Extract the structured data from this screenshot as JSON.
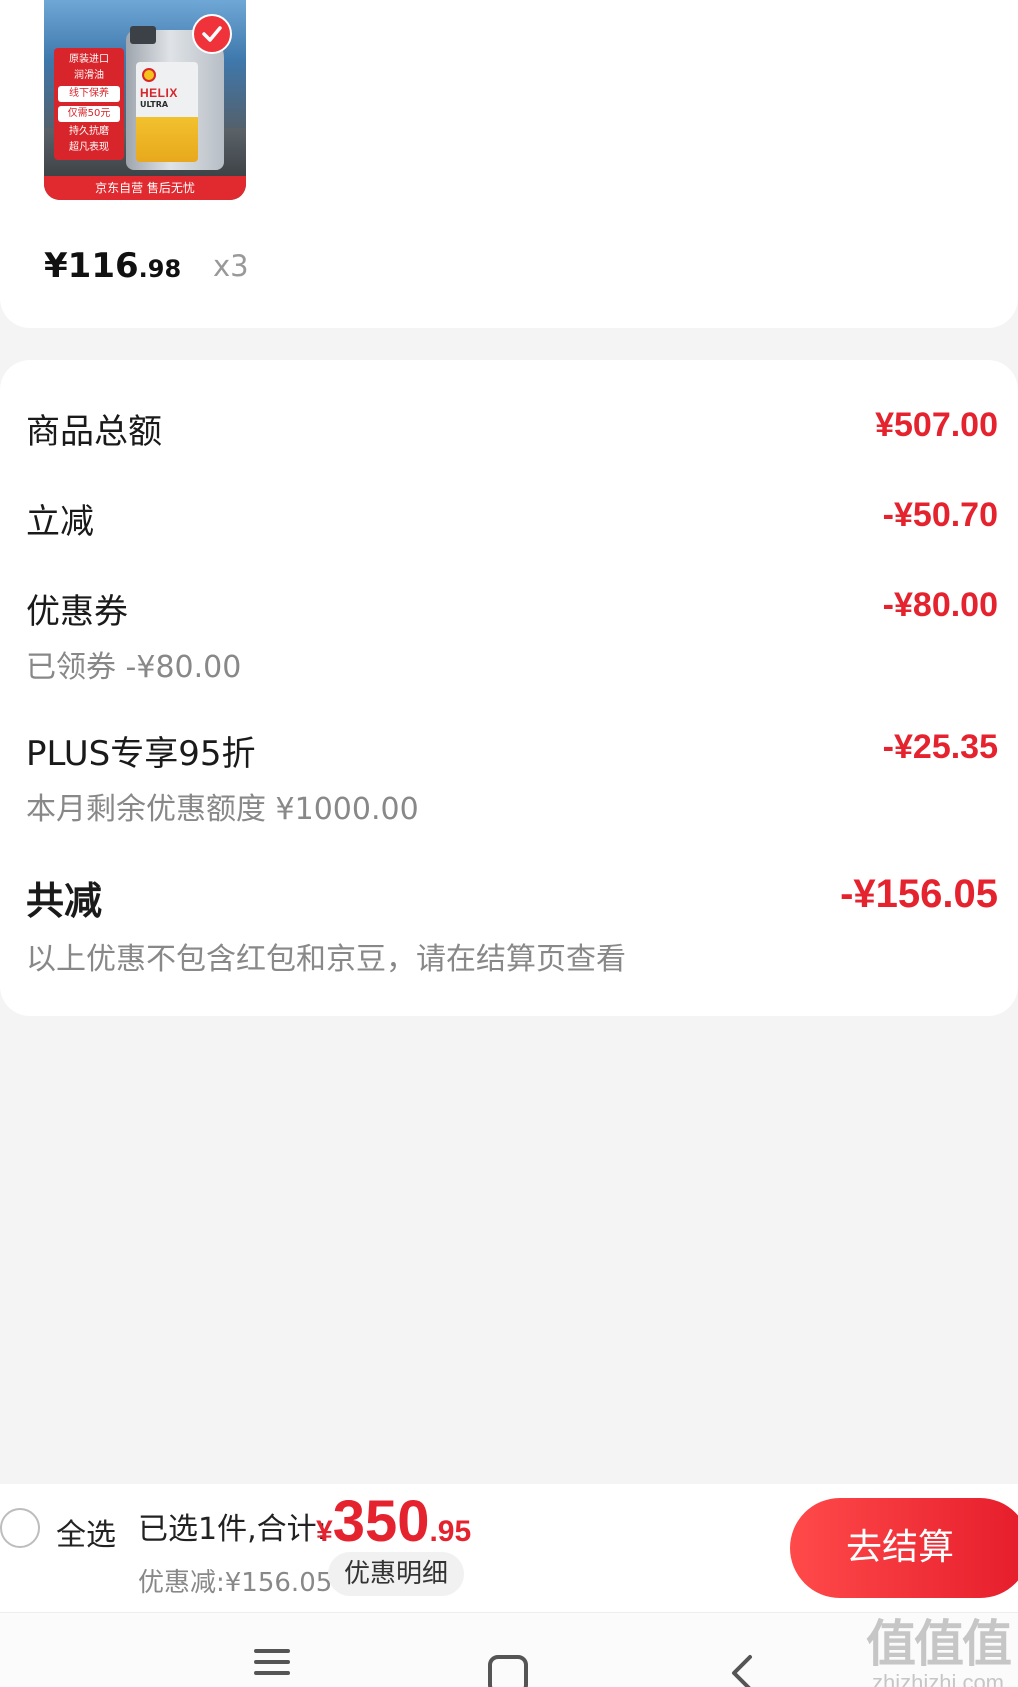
{
  "product": {
    "image_promo_line1": "原装进口",
    "image_promo_line2": "润滑油",
    "image_promo_mid1": "线下保养",
    "image_promo_mid2": "仅需50元",
    "image_promo_line3": "持久抗磨",
    "image_promo_line4": "超凡表现",
    "image_brand": "HELIX",
    "image_sub": "ULTRA",
    "image_banner": "京东自营 售后无忧",
    "price_integer": "¥116",
    "price_cents": ".98",
    "quantity": "x3"
  },
  "summary": {
    "goods_total_label": "商品总额",
    "goods_total_value": "¥507.00",
    "instant_discount_label": "立减",
    "instant_discount_value": "-¥50.70",
    "coupon_label": "优惠券",
    "coupon_value": "-¥80.00",
    "coupon_sub": "已领券 -¥80.00",
    "plus_label": "PLUS专享95折",
    "plus_value": "-¥25.35",
    "plus_sub": "本月剩余优惠额度 ¥1000.00",
    "total_discount_label": "共减",
    "total_discount_value": "-¥156.05",
    "total_discount_note": "以上优惠不包含红包和京豆，请在结算页查看"
  },
  "bottom_bar": {
    "select_all_label": "全选",
    "selected_info": "已选1件,合计:",
    "total_symbol": "¥",
    "total_integer": "350",
    "total_decimal": ".95",
    "discount_line": "优惠减:¥156.05",
    "discount_detail_label": "优惠明细",
    "checkout_label": "去结算"
  },
  "watermark": {
    "glyphs": "值值值",
    "url": "zhizhizhi.com"
  },
  "colors": {
    "accent_red": "#e4232f",
    "checkout_gradient_start": "#ff4a4a",
    "checkout_gradient_end": "#e51c2b"
  },
  "icons": {
    "selected_check": "check-icon",
    "nav_menu": "menu-icon",
    "nav_home": "home-icon",
    "nav_back": "back-icon"
  }
}
